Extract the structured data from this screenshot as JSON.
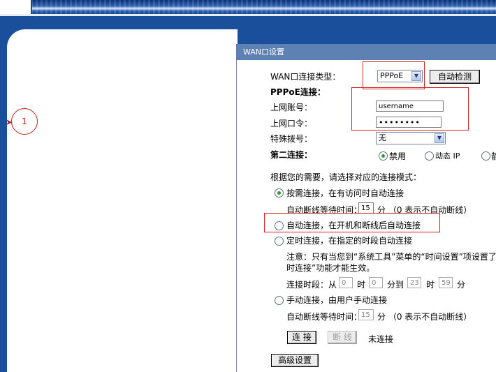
{
  "marker_label": "1",
  "panel": {
    "title": "WAN口设置",
    "wan_type_label": "WAN口连接类型：",
    "wan_type_value": "PPPoE",
    "auto_detect_btn": "自动检测",
    "pppoe_section": "PPPoE连接：",
    "account_label": "上网账号：",
    "account_value": "username",
    "password_label": "上网口令：",
    "password_value": "••••••••",
    "special_dial_label": "特殊拨号：",
    "special_dial_value": "无",
    "second_conn_label": "第二连接：",
    "second_opts": [
      "禁用",
      "动态 IP",
      "静"
    ],
    "mode_intro": "根据您的需要，请选择对应的连接模式：",
    "on_demand_label": "按需连接，在有访问时自动连接",
    "idle_label_1": "自动断线等待时间：",
    "idle_value_1": "15",
    "idle_unit_1": "分 （0 表示不自动断线）",
    "auto_conn_label": "自动连接，在开机和断线后自动连接",
    "timed_conn_label": "定时连接，在指定的时段自动连接",
    "note_line1": "注意：只有当您到“系统工具”菜单的“时间设置”项设置了",
    "note_line2": "时连接”功能才能生效。",
    "period_label": "连接时段：从",
    "period_h1": "0",
    "period_t1": "时",
    "period_m1": "0",
    "period_t2": "分到",
    "period_h2": "23",
    "period_t3": "时",
    "period_m2": "59",
    "period_t4": "分",
    "manual_label": "手动连接，由用户手动连接",
    "idle_label_2": "自动断线等待时间：",
    "idle_value_2": "15",
    "idle_unit_2": "分 （0 表示不自动断线）",
    "connect_btn": "连 接",
    "disconnect_btn": "断 线",
    "status_text": "未连接",
    "advanced_btn": "高级设置"
  }
}
